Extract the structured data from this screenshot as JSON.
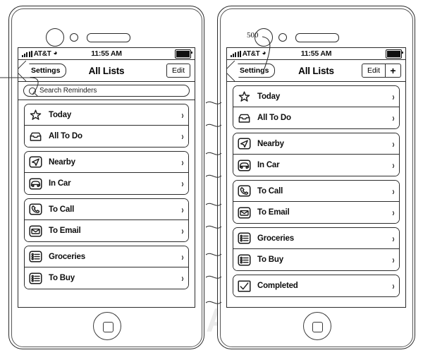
{
  "figure": {
    "reference_number": "500",
    "watermark": "AppleInsider"
  },
  "status_bar": {
    "carrier": "AT&T",
    "time": "11:55 AM",
    "signal_icon": "signal-bars-icon",
    "wifi_icon": "wifi-icon",
    "battery_icon": "battery-icon"
  },
  "left_phone": {
    "nav": {
      "back_label": "Settings",
      "title": "All Lists",
      "edit_label": "Edit"
    },
    "search": {
      "placeholder": "Search Reminders",
      "icon": "search-icon"
    },
    "groups": [
      {
        "rows": [
          {
            "label": "Today",
            "icon": "star-icon",
            "chevron": "›"
          },
          {
            "label": "All To Do",
            "icon": "inbox-icon",
            "chevron": "›"
          }
        ]
      },
      {
        "rows": [
          {
            "label": "Nearby",
            "icon": "location-arrow-icon",
            "chevron": "›"
          },
          {
            "label": "In Car",
            "icon": "car-icon",
            "chevron": "›"
          }
        ]
      },
      {
        "rows": [
          {
            "label": "To Call",
            "icon": "phone-icon",
            "chevron": "›"
          },
          {
            "label": "To Email",
            "icon": "envelope-icon",
            "chevron": "›"
          }
        ]
      },
      {
        "rows": [
          {
            "label": "Groceries",
            "icon": "list-icon",
            "chevron": "›"
          },
          {
            "label": "To Buy",
            "icon": "list-icon",
            "chevron": "›"
          }
        ]
      }
    ]
  },
  "right_phone": {
    "nav": {
      "back_label": "Settings",
      "title": "All Lists",
      "edit_label": "Edit",
      "add_label": "+"
    },
    "groups": [
      {
        "rows": [
          {
            "label": "Today",
            "icon": "star-icon",
            "chevron": "›"
          },
          {
            "label": "All To Do",
            "icon": "inbox-icon",
            "chevron": "›"
          }
        ]
      },
      {
        "rows": [
          {
            "label": "Nearby",
            "icon": "location-arrow-icon",
            "chevron": "›"
          },
          {
            "label": "In Car",
            "icon": "car-icon",
            "chevron": "›"
          }
        ]
      },
      {
        "rows": [
          {
            "label": "To Call",
            "icon": "phone-icon",
            "chevron": "›"
          },
          {
            "label": "To Email",
            "icon": "envelope-icon",
            "chevron": "›"
          }
        ]
      },
      {
        "rows": [
          {
            "label": "Groceries",
            "icon": "list-icon",
            "chevron": "›"
          },
          {
            "label": "To Buy",
            "icon": "list-icon",
            "chevron": "›"
          }
        ]
      },
      {
        "rows": [
          {
            "label": "Completed",
            "icon": "checkmark-icon",
            "chevron": "›"
          }
        ]
      }
    ]
  }
}
